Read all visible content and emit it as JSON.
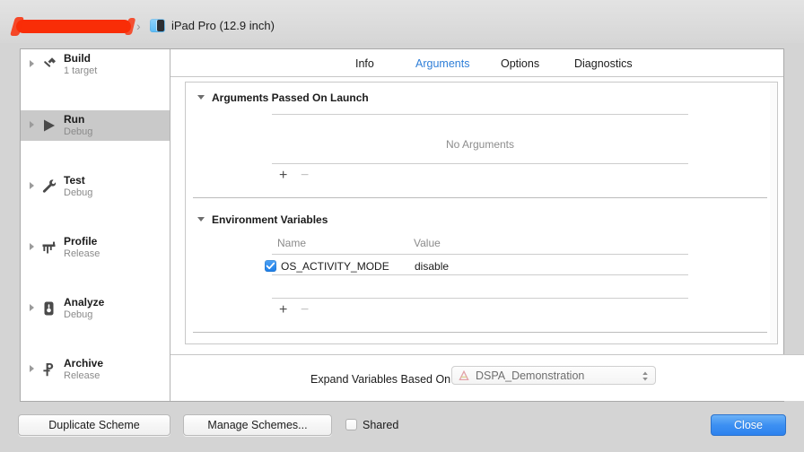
{
  "titlebar": {
    "scheme_name_redacted": "",
    "separator": "›",
    "device_icon": "ipad-device-icon",
    "device_name": "iPad Pro (12.9 inch)"
  },
  "sidebar": {
    "items": [
      {
        "title": "Build",
        "subtitle": "1 target",
        "icon": "hammer-icon",
        "selected": false
      },
      {
        "title": "Run",
        "subtitle": "Debug",
        "icon": "play-icon",
        "selected": true
      },
      {
        "title": "Test",
        "subtitle": "Debug",
        "icon": "wrench-icon",
        "selected": false
      },
      {
        "title": "Profile",
        "subtitle": "Release",
        "icon": "gauge-icon",
        "selected": false
      },
      {
        "title": "Analyze",
        "subtitle": "Debug",
        "icon": "analyze-icon",
        "selected": false
      },
      {
        "title": "Archive",
        "subtitle": "Release",
        "icon": "archive-icon",
        "selected": false
      }
    ]
  },
  "tabs": [
    {
      "label": "Info",
      "active": false
    },
    {
      "label": "Arguments",
      "active": true
    },
    {
      "label": "Options",
      "active": false
    },
    {
      "label": "Diagnostics",
      "active": false
    }
  ],
  "arguments_section": {
    "heading": "Arguments Passed On Launch",
    "empty_text": "No Arguments",
    "add_button": "+",
    "remove_button": "−"
  },
  "environment_section": {
    "heading": "Environment Variables",
    "columns": {
      "name": "Name",
      "value": "Value"
    },
    "rows": [
      {
        "enabled": true,
        "name": "OS_ACTIVITY_MODE",
        "value": "disable"
      }
    ],
    "add_button": "+",
    "remove_button": "−"
  },
  "expand_variables": {
    "label": "Expand Variables Based On",
    "selected": "DSPA_Demonstration",
    "icon": "xcode-project-icon"
  },
  "bottom_bar": {
    "duplicate_scheme": "Duplicate Scheme",
    "manage_schemes": "Manage Schemes...",
    "shared_label": "Shared",
    "shared_checked": false,
    "close": "Close"
  },
  "colors": {
    "accent_blue": "#2f7fd8",
    "default_button_blue": "#3d90f2",
    "checkbox_blue": "#1b7de8",
    "redaction_red": "#f92d07",
    "window_gray": "#d4d4d4"
  }
}
